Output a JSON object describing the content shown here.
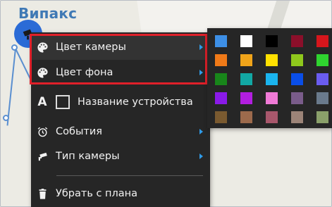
{
  "map": {
    "title": "Випакс"
  },
  "menu": {
    "items": [
      {
        "id": "camera-color",
        "icon": "palette-icon",
        "label": "Цвет камеры",
        "submenu": true
      },
      {
        "id": "background-color",
        "icon": "palette-icon",
        "label": "Цвет фона",
        "submenu": true
      },
      {
        "id": "device-name",
        "icon": "text-icon",
        "icon_text": "A",
        "label": "Название устройства",
        "checkbox": true,
        "checked": false
      },
      {
        "id": "events",
        "icon": "alarm-clock-icon",
        "label": "События",
        "submenu": true
      },
      {
        "id": "camera-type",
        "icon": "camera-icon",
        "label": "Тип камеры",
        "submenu": true
      },
      {
        "id": "remove",
        "icon": "trash-icon",
        "label": "Убрать с плана",
        "submenu": false
      }
    ],
    "accent_color": "#2f9be8",
    "highlight_color": "#e0202a"
  },
  "palette": {
    "rows": [
      [
        "#3d8fe6",
        "#ffffff",
        "#000000",
        "#8b0f2a",
        "#d6161c"
      ],
      [
        "#f07a18",
        "#f0a41a",
        "#ffe000",
        "#8fc81c",
        "#2fd42f"
      ],
      [
        "#18861a",
        "#12a8a4",
        "#1ab4ee",
        "#0a4ee8",
        "#6a5cf0"
      ],
      [
        "#8a1ae8",
        "#b21ee0",
        "#f07ad6",
        "#7a5c8a",
        "#6a7a8c"
      ],
      [
        "#7a5a30",
        "#9c6a4c",
        "#a8576c",
        "#9c8478",
        "#8aa06a"
      ]
    ]
  }
}
